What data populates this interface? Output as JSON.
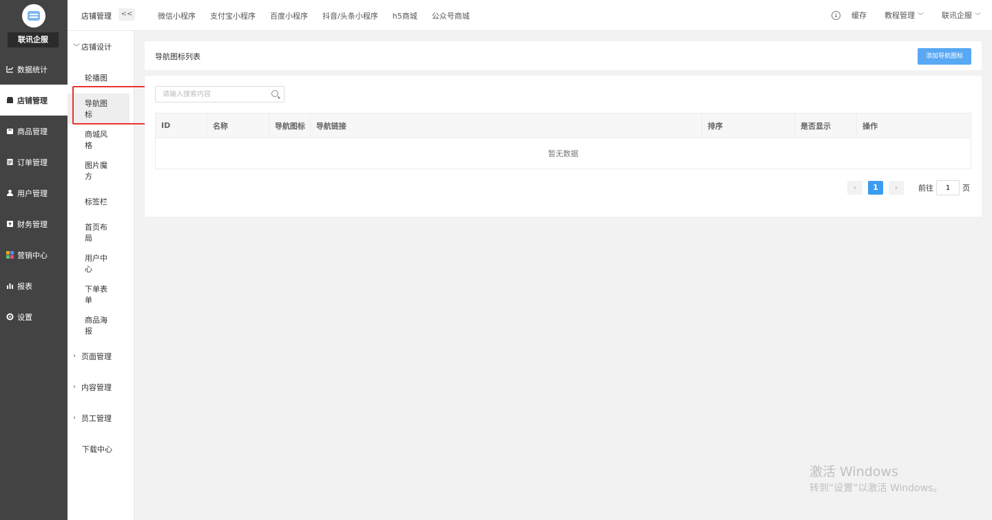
{
  "brand": {
    "name": "联讯企服"
  },
  "rail": {
    "items": [
      {
        "label": "数据统计",
        "icon": "chart-line-icon"
      },
      {
        "label": "店铺管理",
        "icon": "store-icon",
        "active": true
      },
      {
        "label": "商品管理",
        "icon": "goods-icon"
      },
      {
        "label": "订单管理",
        "icon": "order-icon"
      },
      {
        "label": "用户管理",
        "icon": "user-icon"
      },
      {
        "label": "财务管理",
        "icon": "finance-icon"
      },
      {
        "label": "营销中心",
        "icon": "marketing-icon"
      },
      {
        "label": "报表",
        "icon": "report-icon"
      },
      {
        "label": "设置",
        "icon": "gear-icon"
      }
    ]
  },
  "topbar": {
    "breadcrumb": "店铺管理",
    "collapse_label": "<<",
    "tabs": [
      "微信小程序",
      "支付宝小程序",
      "百度小程序",
      "抖音/头条小程序",
      "h5商城",
      "公众号商城"
    ],
    "cache_label": "缓存",
    "tutorial_label": "教程管理",
    "account_label": "联讯企服"
  },
  "subnav": {
    "group_design": "店铺设计",
    "items": [
      "轮播图",
      "导航图标",
      "商城风格",
      "图片魔方",
      "标签栏",
      "首页布局",
      "用户中心",
      "下单表单",
      "商品海报"
    ],
    "group_page": "页面管理",
    "group_content": "内容管理",
    "group_staff": "员工管理",
    "download": "下载中心"
  },
  "content": {
    "title": "导航图标列表",
    "add_button": "添加导航图标",
    "search_placeholder": "请输入搜索内容",
    "columns": [
      "ID",
      "名称",
      "导航图标",
      "导航链接",
      "排序",
      "是否显示",
      "操作"
    ],
    "empty_text": "暂无数据",
    "pagination": {
      "current": "1",
      "goto_prefix": "前往",
      "goto_value": "1",
      "goto_suffix": "页"
    }
  },
  "watermark": {
    "line1": "激活 Windows",
    "line2": "转到“设置”以激活 Windows。"
  }
}
